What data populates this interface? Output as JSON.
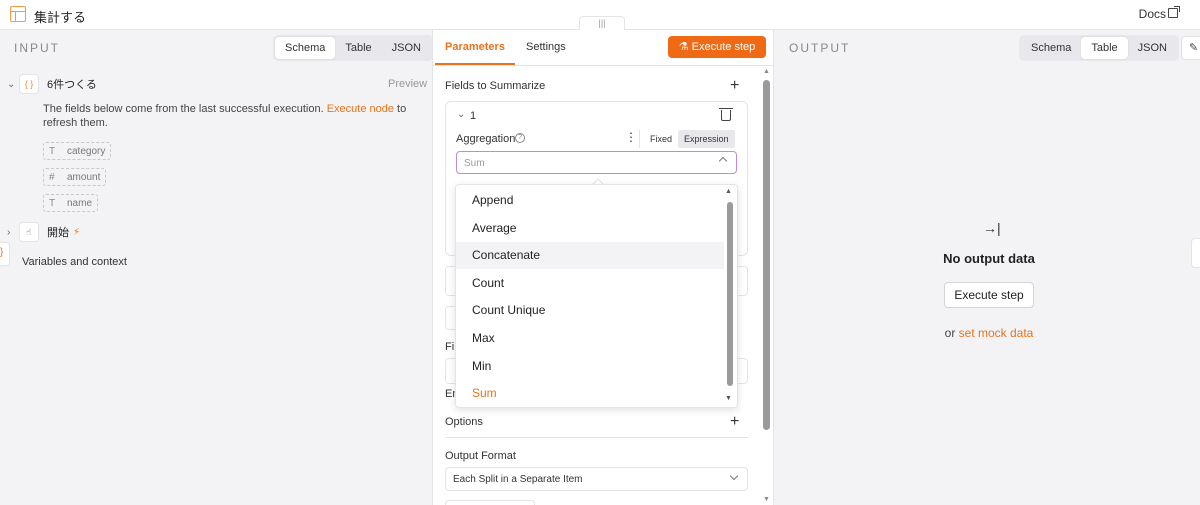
{
  "titlebar": {
    "title": "集計する",
    "docs": "Docs"
  },
  "input": {
    "label": "INPUT",
    "views": [
      "Schema",
      "Table",
      "JSON"
    ],
    "node": {
      "badge": "{ }",
      "name": "6件つくる",
      "preview": "Preview"
    },
    "info_pre": "The fields below come from the last successful execution. ",
    "info_link": "Execute node",
    "info_post": " to refresh them.",
    "fields": [
      {
        "icon": "T",
        "name": "category"
      },
      {
        "icon": "#",
        "name": "amount"
      },
      {
        "icon": "T",
        "name": "name"
      }
    ],
    "node2": {
      "name": "開始"
    },
    "variables": "Variables and context",
    "brace": "}"
  },
  "params": {
    "tabs": [
      "Parameters",
      "Settings"
    ],
    "execute_step": "Execute step",
    "fields_to_summarize": "Fields to Summarize",
    "item_index": "1",
    "aggregation_label": "Aggregation",
    "mode_fixed": "Fixed",
    "mode_expression": "Expression",
    "aggregation_value": "Sum",
    "partial_fi": "Fi",
    "partial_en": "En",
    "options": "Options",
    "output_format_label": "Output Format",
    "output_format_value": "Each Split in a Separate Item"
  },
  "dropdown": {
    "options": [
      "Append",
      "Average",
      "Concatenate",
      "Count",
      "Count Unique",
      "Max",
      "Min",
      "Sum"
    ],
    "hovered": "Concatenate",
    "selected": "Sum"
  },
  "output": {
    "label": "OUTPUT",
    "views": [
      "Schema",
      "Table",
      "JSON"
    ],
    "empty_title": "No output data",
    "execute_step": "Execute step",
    "or": "or ",
    "mock_link": "set mock data"
  },
  "colors": {
    "accent": "#e8731b",
    "button": "#f06a15",
    "focus": "#b98be3"
  }
}
